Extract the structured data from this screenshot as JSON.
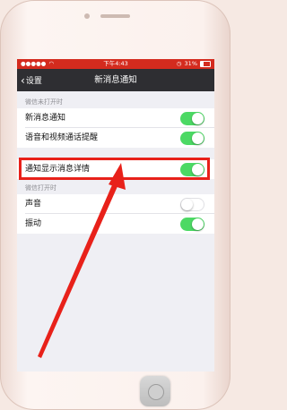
{
  "status_bar": {
    "time": "下午4:43",
    "battery": "31%",
    "signal_icon": "signal-bars-icon",
    "wifi_icon": "wifi-icon",
    "alarm_icon": "alarm-icon"
  },
  "nav": {
    "back_label": "设置",
    "title": "新消息通知"
  },
  "sections": [
    {
      "header": "微信未打开时",
      "rows": [
        {
          "label": "新消息通知",
          "toggle": "on"
        },
        {
          "label": "语音和视频通话提醒",
          "toggle": "on"
        },
        {
          "label": "通知显示消息详情",
          "toggle": "on"
        }
      ]
    },
    {
      "header": "微信打开时",
      "rows": [
        {
          "label": "声音",
          "toggle": "off"
        },
        {
          "label": "振动",
          "toggle": "on"
        }
      ]
    }
  ],
  "colors": {
    "status_bar": "#d42b1e",
    "nav_bar": "#2e2e32",
    "toggle_on": "#4cd964",
    "annotation": "#e8211a"
  }
}
